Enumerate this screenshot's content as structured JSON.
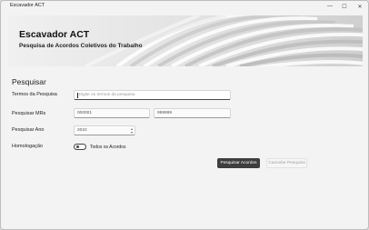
{
  "window": {
    "title": "Escavador ACT",
    "controls": {
      "minimize": "—",
      "maximize": "☐",
      "close": "✕"
    }
  },
  "banner": {
    "title": "Escavador ACT",
    "subtitle": "Pesquisa de Acordos Coletivos do Trabalho"
  },
  "form": {
    "section_title": "Pesquisar",
    "terms": {
      "label": "Termos da Pesquisa",
      "placeholder": "Digite os termos da pesquisa",
      "value": ""
    },
    "mrs": {
      "label": "Pesquisar MRs",
      "from": "000001",
      "to": "999999"
    },
    "year": {
      "label": "Pesquisar Ano",
      "value": "2022"
    },
    "homologacao": {
      "label": "Homologação",
      "toggle_label": "Todos os Acordos",
      "toggle_on": false
    }
  },
  "buttons": {
    "search": "Pesquisar Acordos",
    "cancel": "Cancelar Pesquisa"
  },
  "colors": {
    "primary_button": "#3e3e3e",
    "window_bg": "#f3f3f3"
  }
}
